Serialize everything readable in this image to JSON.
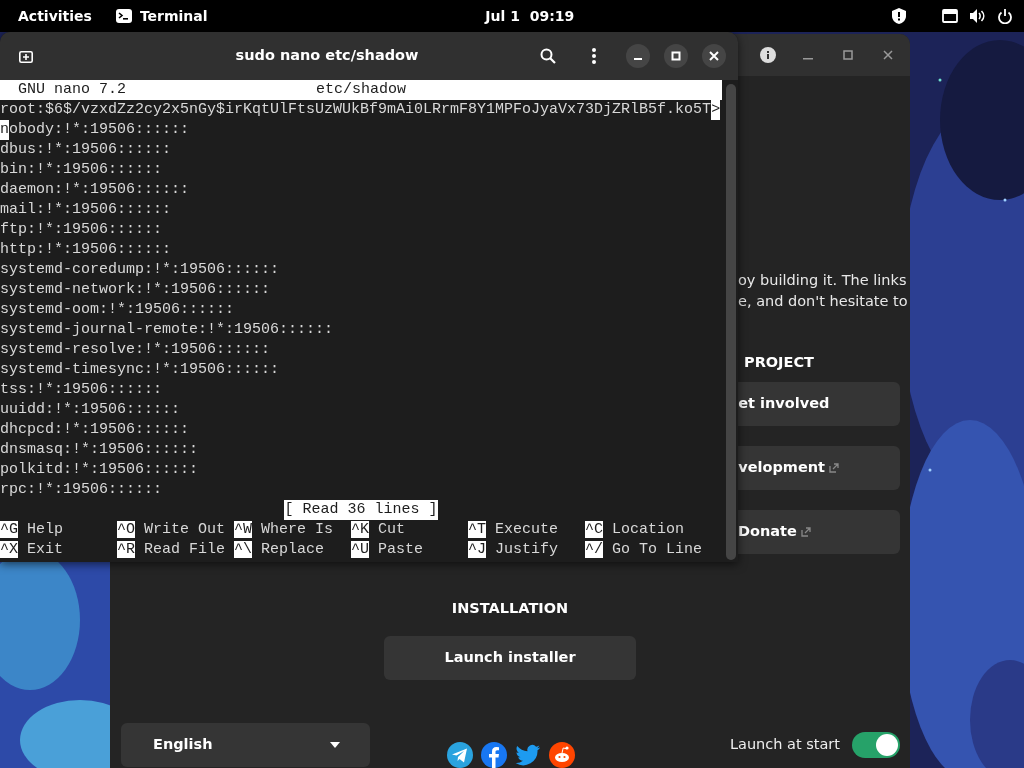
{
  "top_bar": {
    "activities": "Activities",
    "app_name": "Terminal",
    "clock": "Jul 1  09:19"
  },
  "terminal": {
    "title": "sudo nano etc/shadow",
    "nano": {
      "version": "GNU nano 7.2",
      "file": "etc/shadow",
      "lines": [
        {
          "text": "root:$6$/vzxdZz2cy2x5nGy$irKqtUlFtsUzWUkBf9mAi0LRrmF8Y1MPFoJyaVx73DjZRlB5f.ko5T",
          "overflow": ">",
          "cursor": false
        },
        {
          "text": "nobody:!*:19506::::::",
          "cursor": true
        },
        {
          "text": "dbus:!*:19506::::::",
          "cursor": false
        },
        {
          "text": "bin:!*:19506::::::",
          "cursor": false
        },
        {
          "text": "daemon:!*:19506::::::",
          "cursor": false
        },
        {
          "text": "mail:!*:19506::::::",
          "cursor": false
        },
        {
          "text": "ftp:!*:19506::::::",
          "cursor": false
        },
        {
          "text": "http:!*:19506::::::",
          "cursor": false
        },
        {
          "text": "systemd-coredump:!*:19506::::::",
          "cursor": false
        },
        {
          "text": "systemd-network:!*:19506::::::",
          "cursor": false
        },
        {
          "text": "systemd-oom:!*:19506::::::",
          "cursor": false
        },
        {
          "text": "systemd-journal-remote:!*:19506::::::",
          "cursor": false
        },
        {
          "text": "systemd-resolve:!*:19506::::::",
          "cursor": false
        },
        {
          "text": "systemd-timesync:!*:19506::::::",
          "cursor": false
        },
        {
          "text": "tss:!*:19506::::::",
          "cursor": false
        },
        {
          "text": "uuidd:!*:19506::::::",
          "cursor": false
        },
        {
          "text": "dhcpcd:!*:19506::::::",
          "cursor": false
        },
        {
          "text": "dnsmasq:!*:19506::::::",
          "cursor": false
        },
        {
          "text": "polkitd:!*:19506::::::",
          "cursor": false
        },
        {
          "text": "rpc:!*:19506::::::",
          "cursor": false
        }
      ],
      "status": "[ Read 36 lines ]",
      "shortcuts": [
        [
          {
            "key": "^G",
            "label": "Help"
          },
          {
            "key": "^O",
            "label": "Write Out"
          },
          {
            "key": "^W",
            "label": "Where Is"
          },
          {
            "key": "^K",
            "label": "Cut"
          },
          {
            "key": "^T",
            "label": "Execute"
          },
          {
            "key": "^C",
            "label": "Location"
          }
        ],
        [
          {
            "key": "^X",
            "label": "Exit"
          },
          {
            "key": "^R",
            "label": "Read File"
          },
          {
            "key": "^\\",
            "label": "Replace"
          },
          {
            "key": "^U",
            "label": "Paste"
          },
          {
            "key": "^J",
            "label": "Justify"
          },
          {
            "key": "^/",
            "label": "Go To Line"
          }
        ]
      ]
    }
  },
  "welcome": {
    "intro_lines": [
      "oy building it. The links",
      "e, and don't hesitate to"
    ],
    "project_heading": "PROJECT",
    "project_buttons": [
      {
        "label": "et involved",
        "external": false
      },
      {
        "label": "velopment",
        "external": true
      },
      {
        "label": "Donate",
        "external": true
      }
    ],
    "installation_heading": "INSTALLATION",
    "installer_button": "Launch installer",
    "language": "English",
    "launch_at_start": {
      "label": "Launch at start",
      "on": true
    }
  }
}
